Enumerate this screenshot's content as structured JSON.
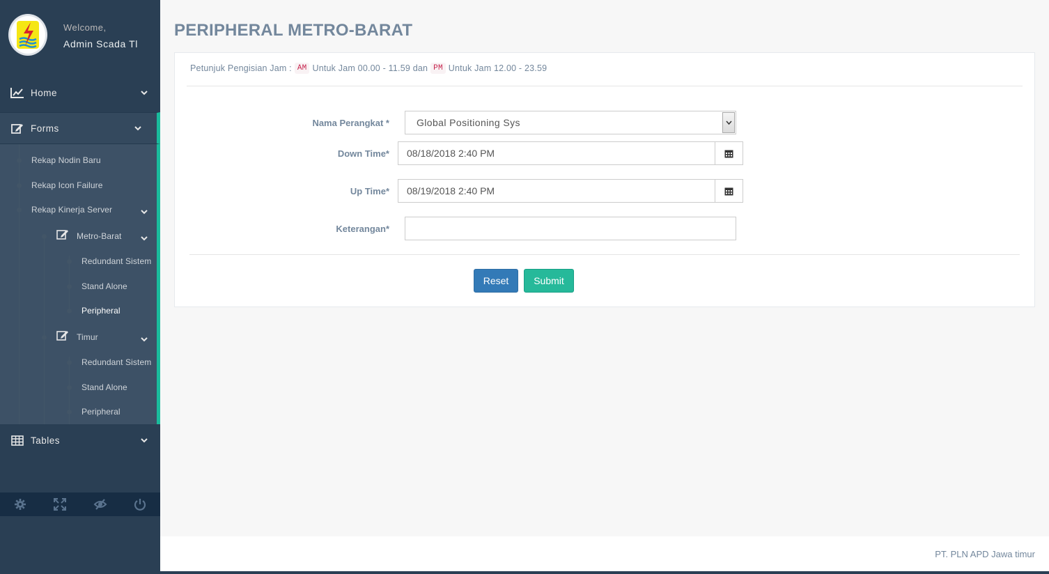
{
  "profile": {
    "welcome": "Welcome,",
    "name": "Admin Scada Tl"
  },
  "menu": {
    "home": "Home",
    "forms": "Forms",
    "tables": "Tables",
    "forms_items": {
      "rekap_nodin": "Rekap Nodin Baru",
      "rekap_icon": "Rekap Icon Failure",
      "rekap_kinerja": "Rekap Kinerja Server",
      "metro_barat": "Metro-Barat",
      "mb_redundant": "Redundant Sistem",
      "mb_standalone": "Stand Alone",
      "mb_peripheral": "Peripheral",
      "timur": "Timur",
      "t_redundant": "Redundant Sistem",
      "t_standalone": "Stand Alone",
      "t_peripheral": "Peripheral"
    }
  },
  "footer_icons": [
    "gear-icon",
    "fullscreen-icon",
    "eye-slash-icon",
    "power-icon"
  ],
  "page": {
    "title": "PERIPHERAL METRO-BARAT",
    "hint_prefix": "Petunjuk Pengisian Jam :",
    "hint_am": "AM",
    "hint_am_text": "Untuk Jam 00.00 - 11.59 dan",
    "hint_pm": "PM",
    "hint_pm_text": "Untuk Jam 12.00 - 23.59"
  },
  "form": {
    "nama_label": "Nama Perangkat *",
    "nama_value": "Global Positioning Sys",
    "down_label": "Down Time*",
    "down_value": "08/18/2018 2:40 PM",
    "up_label": "Up Time*",
    "up_value": "08/19/2018 2:40 PM",
    "keterangan_label": "Keterangan*",
    "keterangan_value": "",
    "reset_label": "Reset",
    "submit_label": "Submit"
  },
  "footer": {
    "text": "PT. PLN APD Jawa timur"
  },
  "colors": {
    "sidebar": "#2a3f54",
    "accent": "#1abb9c",
    "primary": "#337ab7",
    "success": "#26b99a",
    "text": "#73879c"
  }
}
